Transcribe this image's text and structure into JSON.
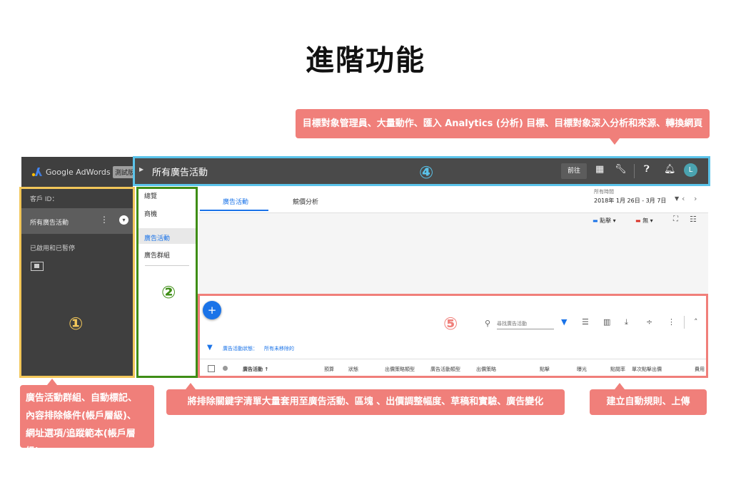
{
  "title": "進階功能",
  "callouts": {
    "c4": "目標對象管理員、大量動作、匯入 Analytics (分析) 目標、目標對象深入分析和來源、轉換網頁",
    "c1_line1": "廣告活動群組、自動標記、",
    "c1_line2": "內容排除條件(帳戶層級)、",
    "c1_line3": "網址選項/追蹤範本(帳戶層級)",
    "c2": "將排除關鍵字清單大量套用至廣告活動、區塊 、出價調整幅度、草稿和實驗、廣告變化",
    "c5": "建立自動規則、上傳"
  },
  "markers": {
    "n1": "①",
    "n2": "②",
    "n4": "④",
    "n5": "⑤"
  },
  "sidebar": {
    "logo": "Google AdWords",
    "test_badge": "測試版",
    "customer_id": "客戶 ID：",
    "all_campaigns": "所有廣告活動",
    "enabled_paused": "已啟用和已暫停"
  },
  "topbar": {
    "title": "所有廣告活動",
    "go": "前往",
    "avatar": "L"
  },
  "nav": {
    "items": [
      "總覽",
      "商機",
      "廣告活動",
      "廣告群組"
    ]
  },
  "tabs": [
    "廣告活動",
    "競價分析"
  ],
  "date": {
    "label": "所有時間",
    "range": "2018年 1月 26日 - 3月 7日"
  },
  "metrics": {
    "m1": "點擊",
    "m2": "無"
  },
  "search": {
    "placeholder": "尋找廣告活動"
  },
  "filter": {
    "label": "廣告活動狀態：",
    "value": "所有未移除的"
  },
  "columns": [
    "廣告活動",
    "預算",
    "狀態",
    "出價策略類型",
    "廣告活動類型",
    "出價策略",
    "點擊",
    "曝光",
    "點閱率",
    "單次點擊出價",
    "費用"
  ],
  "colors": {
    "callout": "#f07f7a",
    "yellow": "#f3c75a",
    "green": "#3e8d15",
    "blue": "#5ac3ea",
    "accent": "#1a73e8"
  }
}
